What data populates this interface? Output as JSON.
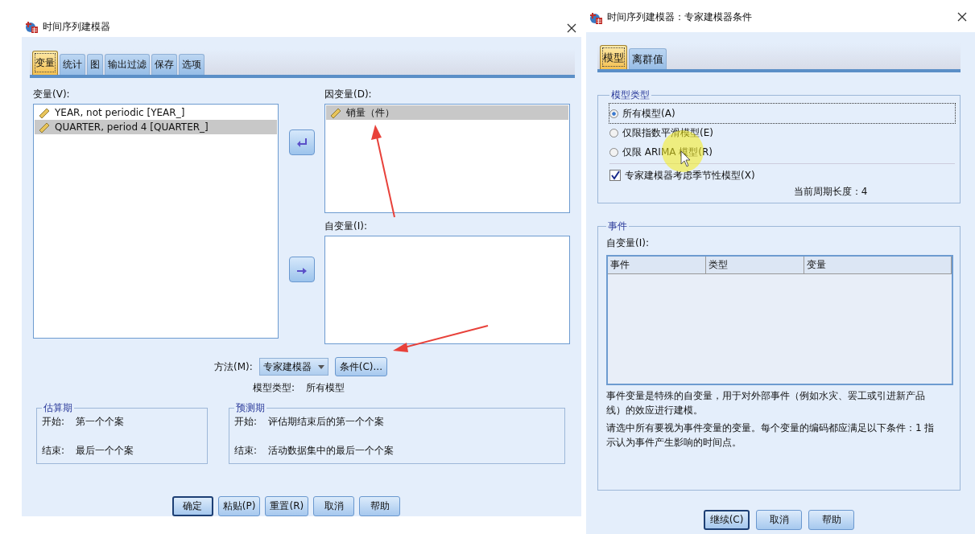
{
  "left_dialog": {
    "title": "时间序列建模器",
    "tabs": [
      {
        "label": "变量",
        "selected": true
      },
      {
        "label": "统计",
        "selected": false
      },
      {
        "label": "图",
        "selected": false
      },
      {
        "label": "输出过滤",
        "selected": false
      },
      {
        "label": "保存",
        "selected": false
      },
      {
        "label": "选项",
        "selected": false
      }
    ],
    "variables_label": "变量(V):",
    "variables": [
      {
        "name": "YEAR, not periodic [YEAR_]",
        "selected": false
      },
      {
        "name": "QUARTER, period 4 [QUARTER_]",
        "selected": true
      }
    ],
    "dependent_label": "因变量(D):",
    "dependent": [
      {
        "name": "销量（件）",
        "selected": true
      }
    ],
    "independent_label": "自变量(I):",
    "method_label": "方法(M):",
    "method_value": "专家建模器",
    "criteria_button": "条件(C)...",
    "model_type_label": "模型类型:",
    "model_type_value": "所有模型",
    "estimation": {
      "title": "估算期",
      "rows": [
        {
          "label": "开始:",
          "value": "第一个个案"
        },
        {
          "label": "结束:",
          "value": "最后一个个案"
        }
      ]
    },
    "forecast": {
      "title": "预测期",
      "rows": [
        {
          "label": "开始:",
          "value": "评估期结束后的第一个个案"
        },
        {
          "label": "结束:",
          "value": "活动数据集中的最后一个个案"
        }
      ]
    },
    "buttons": [
      {
        "label": "确定",
        "default": true
      },
      {
        "label": "粘贴(P)",
        "default": false
      },
      {
        "label": "重置(R)",
        "default": false
      },
      {
        "label": "取消",
        "default": false
      },
      {
        "label": "帮助",
        "default": false
      }
    ]
  },
  "right_dialog": {
    "title": "时间序列建模器：专家建模器条件",
    "tabs": [
      {
        "label": "模型",
        "selected": true
      },
      {
        "label": "离群值",
        "selected": false
      }
    ],
    "model_type": {
      "title": "模型类型",
      "options": [
        {
          "label": "所有模型(A)",
          "selected": true
        },
        {
          "label": "仅限指数平滑模型(E)",
          "selected": false
        },
        {
          "label": "仅限 ARIMA 模型(R)",
          "selected": false
        }
      ],
      "seasonal": {
        "label": "专家建模器考虑季节性模型(X)",
        "checked": true
      },
      "period": "当前周期长度：4"
    },
    "events": {
      "title": "事件",
      "label": "自变量(I):",
      "columns": [
        "事件",
        "类型",
        "变量"
      ],
      "description": [
        "事件变量是特殊的自变量，用于对外部事件（例如水灾、罢工或引进新产品线）的效应进行建模。",
        "请选中所有要视为事件变量的变量。每个变量的编码都应满足以下条件：1 指示认为事件产生影响的时间点。"
      ]
    },
    "buttons": [
      {
        "label": "继续(C)",
        "default": true
      },
      {
        "label": "取消",
        "default": false
      },
      {
        "label": "帮助",
        "default": false
      }
    ]
  }
}
